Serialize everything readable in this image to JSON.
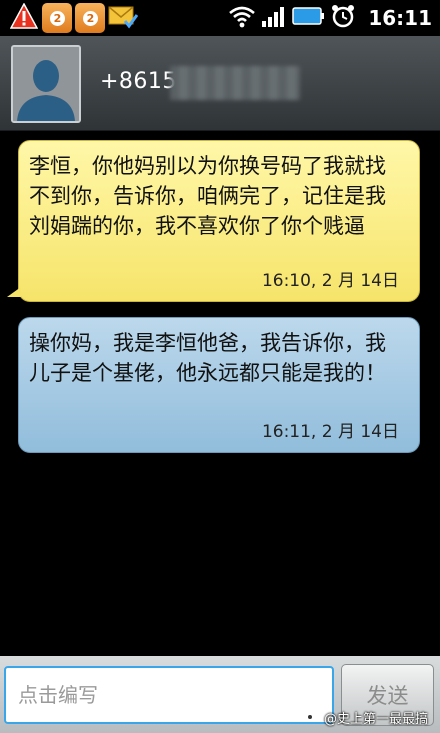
{
  "status_bar": {
    "time": "16:11",
    "weibo_notifications": [
      "2",
      "2"
    ],
    "icons": [
      "warning-icon",
      "weibo-icon",
      "weibo-icon",
      "mail-check-icon",
      "wifi-icon",
      "signal-icon",
      "battery-icon",
      "alarm-icon"
    ]
  },
  "contact": {
    "number": "+8615",
    "avatar_icon": "default-contact-icon"
  },
  "messages": [
    {
      "direction": "incoming",
      "text": "李恒，你他妈别以为你换号码了我就找不到你，告诉你，咱俩完了，记住是我刘娟踹的你，我不喜欢你了你个贱逼",
      "time": "16:10, 2 月 14日",
      "color": "#f8e877"
    },
    {
      "direction": "outgoing",
      "text": "操你妈，我是李恒他爸，我告诉你，我儿子是个基佬，他永远都只能是我的！",
      "time": "16:11, 2 月 14日",
      "color": "#a3c8e2"
    }
  ],
  "compose": {
    "placeholder": "点击编写",
    "send_label": "发送"
  },
  "watermark": {
    "text": "@史上第一最最搞"
  },
  "colors": {
    "accent": "#3aa6ea",
    "header": "#3d4245"
  }
}
